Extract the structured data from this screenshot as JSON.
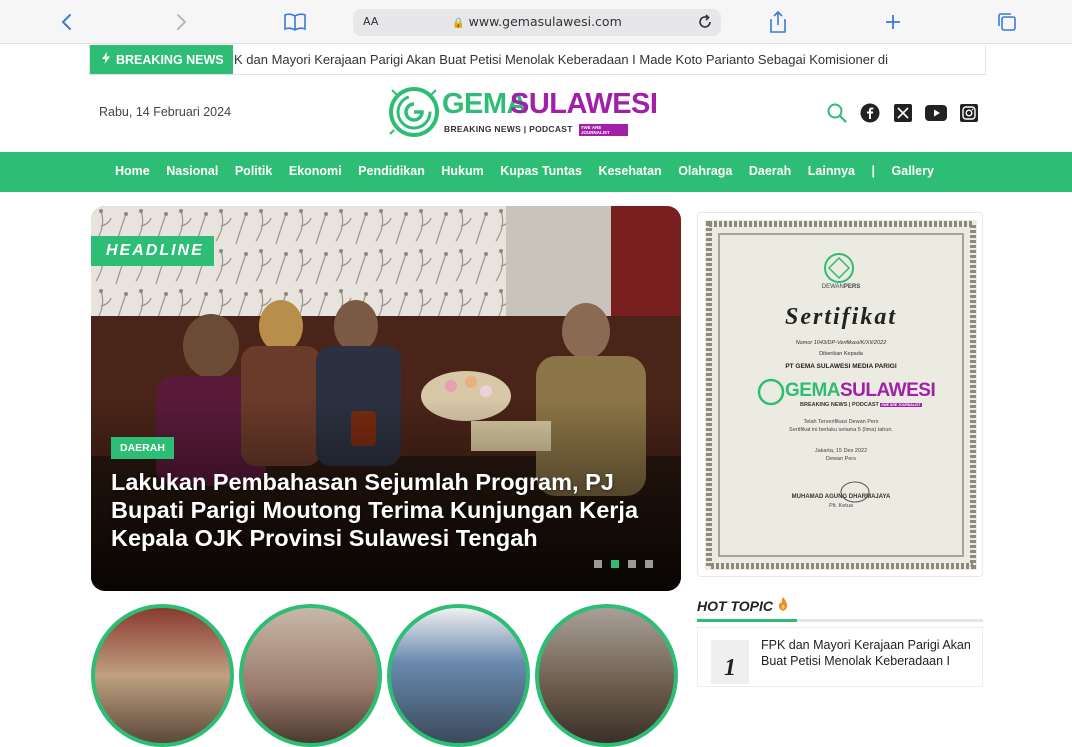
{
  "browser": {
    "text_size_label": "AA",
    "url": "www.gemasulawesi.com"
  },
  "ticker": {
    "badge": "BREAKING NEWS",
    "text": "K dan Mayori Kerajaan Parigi Akan Buat Petisi Menolak Keberadaan I Made Koto Parianto Sebagai Komisioner di"
  },
  "header": {
    "date": "Rabu, 14 Februari 2024",
    "logo_word1": "GEMA",
    "logo_word2": "SULAWESI",
    "logo_tagline": "BREAKING NEWS | PODCAST",
    "logo_tag2": "#WE ARE JOURNALIST",
    "colors": {
      "green": "#2ebd75",
      "purple": "#a020a8"
    }
  },
  "nav": {
    "items": [
      "Home",
      "Nasional",
      "Politik",
      "Ekonomi",
      "Pendidikan",
      "Hukum",
      "Kupas Tuntas",
      "Kesehatan",
      "Olahraga",
      "Daerah",
      "Lainnya",
      "|",
      "Gallery"
    ]
  },
  "headline": {
    "badge": "HEADLINE",
    "category": "DAERAH",
    "title": "Lakukan Pembahasan Sejumlah Program, PJ Bupati Parigi Moutong Terima Kunjungan Kerja Kepala OJK Provinsi Sulawesi Tengah",
    "slides": 4,
    "active_slide": 2
  },
  "certificate": {
    "org_prefix": "DEWAN",
    "org_suffix": "PERS",
    "title": "Sertifikat",
    "number": "Nomor 1043/DP-Verifikasi/K/XII/2022",
    "given_to": "Diberikan Kepada",
    "company": "PT GEMA SULAWESI MEDIA PARIGI",
    "verified": "Telah Terverifikasi Dewan Pers",
    "valid": "Sertifikat ini berlaku selama 5 (lima) tahun.",
    "place_date": "Jakarta, 15 Des 2022",
    "issuer": "Dewan Pers",
    "signer": "MUHAMAD AGUNG DHARMAJAYA",
    "signer_role": "Plt. Ketua"
  },
  "hot_topic": {
    "title": "HOT TOPIC",
    "items": [
      {
        "rank": "1",
        "text": "FPK dan Mayori Kerajaan Parigi Akan Buat Petisi Menolak Keberadaan I"
      }
    ]
  }
}
